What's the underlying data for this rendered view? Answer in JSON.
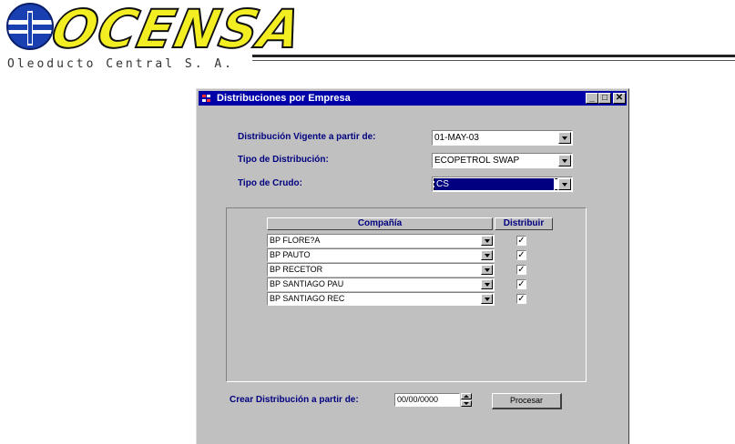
{
  "brand": {
    "logo_text": "OCENSA",
    "subtitle": "Oleoducto Central S. A.",
    "logo_color": "#f2ee22"
  },
  "window": {
    "title": "Distribuciones por Empresa",
    "title_bar_color": "#0000a8",
    "controls": {
      "minimize": "_",
      "maximize": "□",
      "close": "✕"
    }
  },
  "form": {
    "vigente_label": "Distribución Vigente a partir de:",
    "vigente_value": "01-MAY-03",
    "tipo_dist_label": "Tipo de Distribución:",
    "tipo_dist_value": "ECOPETROL SWAP",
    "tipo_crudo_label": "Tipo de Crudo:",
    "tipo_crudo_value": "CS"
  },
  "table": {
    "headers": {
      "company": "Compañía",
      "distribute": "Distribuir"
    },
    "rows": [
      {
        "company": "BP FLORE?A",
        "checked": true,
        "mark": "✓"
      },
      {
        "company": "BP PAUTO",
        "checked": true,
        "mark": "✓"
      },
      {
        "company": "BP RECETOR",
        "checked": true,
        "mark": "✓"
      },
      {
        "company": "BP SANTIAGO PAU",
        "checked": true,
        "mark": "✓"
      },
      {
        "company": "BP SANTIAGO REC",
        "checked": true,
        "mark": "✓"
      }
    ]
  },
  "footer": {
    "crear_label": "Crear Distribución a partir de:",
    "date_value": "00/00/0000",
    "process_button": "Procesar"
  },
  "colors": {
    "label_blue": "#000080",
    "window_face": "#c0c0c0"
  }
}
